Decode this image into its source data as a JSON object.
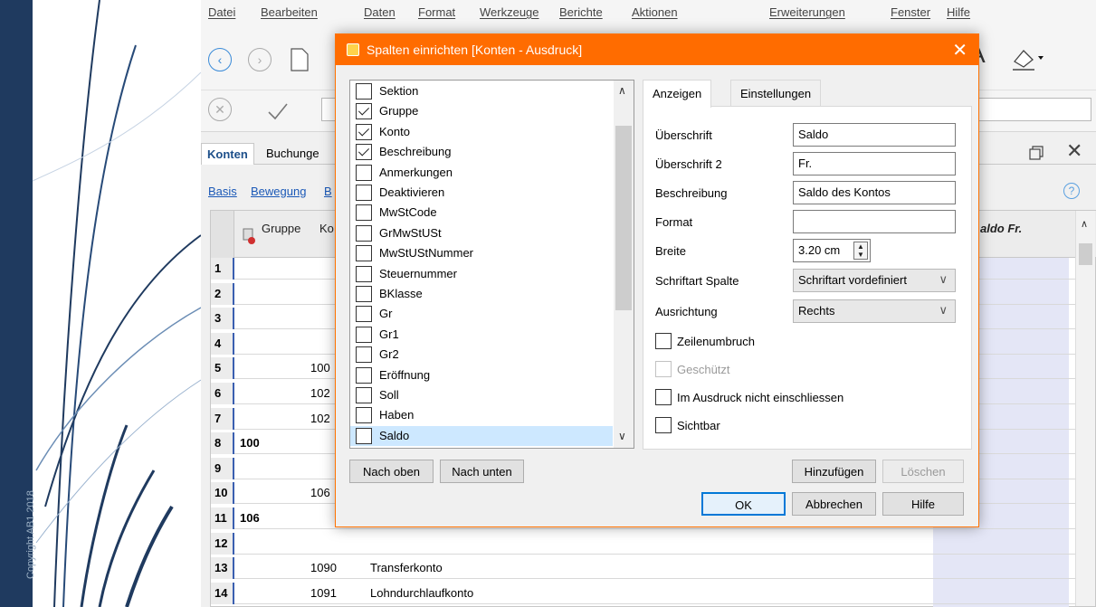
{
  "slide": {
    "copyright": "Copyright AB1 2018"
  },
  "menubar": {
    "items": [
      "Datei",
      "Bearbeiten",
      "Daten",
      "Format",
      "Werkzeuge",
      "Berichte",
      "Aktionen",
      "Erweiterungen",
      "Fenster",
      "Hilfe"
    ]
  },
  "tabs": {
    "konten": "Konten",
    "buchungen": "Buchunge"
  },
  "subtabs": {
    "basis": "Basis",
    "bewegung": "Bewegung",
    "b": "B"
  },
  "grid": {
    "headers": {
      "gruppe": "Gruppe",
      "konto": "Ko",
      "saldo": "aldo Fr."
    },
    "rows": [
      {
        "num": "1",
        "gruppe": "",
        "konto": "",
        "beschreibung": ""
      },
      {
        "num": "2",
        "gruppe": "",
        "konto": "",
        "beschreibung": ""
      },
      {
        "num": "3",
        "gruppe": "",
        "konto": "",
        "beschreibung": ""
      },
      {
        "num": "4",
        "gruppe": "",
        "konto": "",
        "beschreibung": ""
      },
      {
        "num": "5",
        "gruppe": "",
        "konto": "100",
        "beschreibung": ""
      },
      {
        "num": "6",
        "gruppe": "",
        "konto": "102",
        "beschreibung": ""
      },
      {
        "num": "7",
        "gruppe": "",
        "konto": "102",
        "beschreibung": ""
      },
      {
        "num": "8",
        "gruppe": "100",
        "konto": "",
        "beschreibung": ""
      },
      {
        "num": "9",
        "gruppe": "",
        "konto": "",
        "beschreibung": ""
      },
      {
        "num": "10",
        "gruppe": "",
        "konto": "106",
        "beschreibung": ""
      },
      {
        "num": "11",
        "gruppe": "106",
        "konto": "",
        "beschreibung": ""
      },
      {
        "num": "12",
        "gruppe": "",
        "konto": "",
        "beschreibung": ""
      },
      {
        "num": "13",
        "gruppe": "",
        "konto": "1090",
        "beschreibung": "Transferkonto"
      },
      {
        "num": "14",
        "gruppe": "",
        "konto": "1091",
        "beschreibung": "Lohndurchlaufkonto"
      }
    ]
  },
  "dialog": {
    "title": "Spalten einrichten [Konten - Ausdruck]",
    "columns": [
      {
        "label": "Sektion",
        "checked": false
      },
      {
        "label": "Gruppe",
        "checked": true
      },
      {
        "label": "Konto",
        "checked": true
      },
      {
        "label": "Beschreibung",
        "checked": true
      },
      {
        "label": "Anmerkungen",
        "checked": false
      },
      {
        "label": "Deaktivieren",
        "checked": false
      },
      {
        "label": "MwStCode",
        "checked": false
      },
      {
        "label": "GrMwStUSt",
        "checked": false
      },
      {
        "label": "MwStUStNummer",
        "checked": false
      },
      {
        "label": "Steuernummer",
        "checked": false
      },
      {
        "label": "BKlasse",
        "checked": false
      },
      {
        "label": "Gr",
        "checked": false
      },
      {
        "label": "Gr1",
        "checked": false
      },
      {
        "label": "Gr2",
        "checked": false
      },
      {
        "label": "Eröffnung",
        "checked": false
      },
      {
        "label": "Soll",
        "checked": false
      },
      {
        "label": "Haben",
        "checked": false
      },
      {
        "label": "Saldo",
        "checked": false,
        "selected": true
      }
    ],
    "buttons": {
      "nach_oben": "Nach oben",
      "nach_unten": "Nach unten",
      "hinzufuegen": "Hinzufügen",
      "loeschen": "Löschen",
      "ok": "OK",
      "abbrechen": "Abbrechen",
      "hilfe": "Hilfe"
    },
    "tabs": {
      "anzeigen": "Anzeigen",
      "einstellungen": "Einstellungen"
    },
    "fields": {
      "ueberschrift_label": "Überschrift",
      "ueberschrift_value": "Saldo",
      "ueberschrift2_label": "Überschrift 2",
      "ueberschrift2_value": "Fr.",
      "beschreibung_label": "Beschreibung",
      "beschreibung_value": "Saldo des Kontos",
      "format_label": "Format",
      "format_value": "",
      "breite_label": "Breite",
      "breite_value": "3.20 cm",
      "schriftart_label": "Schriftart Spalte",
      "schriftart_value": "Schriftart vordefiniert",
      "ausrichtung_label": "Ausrichtung",
      "ausrichtung_value": "Rechts",
      "zeilenumbruch": "Zeilenumbruch",
      "geschuetzt": "Geschützt",
      "nicht_einschliessen": "Im Ausdruck nicht einschliessen",
      "sichtbar": "Sichtbar"
    }
  }
}
